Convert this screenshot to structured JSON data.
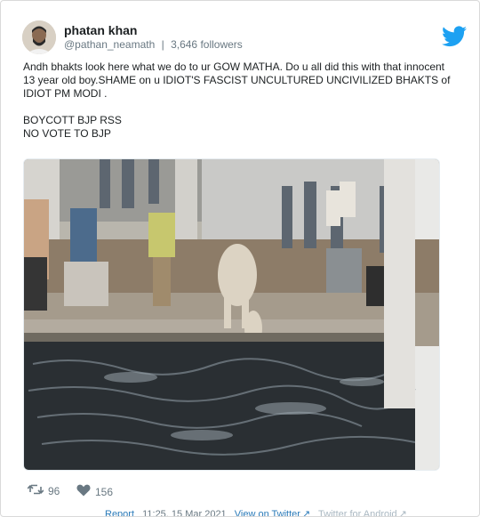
{
  "tweet": {
    "author_name": "phatan khan",
    "handle": "@pathan_neamath",
    "separator": "|",
    "followers": "3,646 followers",
    "text_lines": [
      "Andh bhakts look here what we do to ur GOW MATHA. Do u all did this with that innocent",
      "13 year old boy.SHAME on u IDIOT'S FASCIST UNCULTURED UNCIVILIZED BHAKTS of",
      "IDIOT PM MODI .",
      "BOYCOTT BJP RSS",
      "NO VOTE TO BJP"
    ],
    "retweets": "96",
    "likes": "156"
  },
  "footer": {
    "report": "Report",
    "time": "11:25, 15 Mar 2021",
    "view_on_twitter": "View on Twitter",
    "twitter_for_android": "Twitter for Android"
  },
  "colors": {
    "twitter_blue": "#1da1f2",
    "meta_gray": "#697882",
    "link_blue": "#2b7bb9"
  },
  "icons": [
    "twitter-bird-icon",
    "retweet-icon",
    "heart-icon",
    "external-link-icon"
  ]
}
